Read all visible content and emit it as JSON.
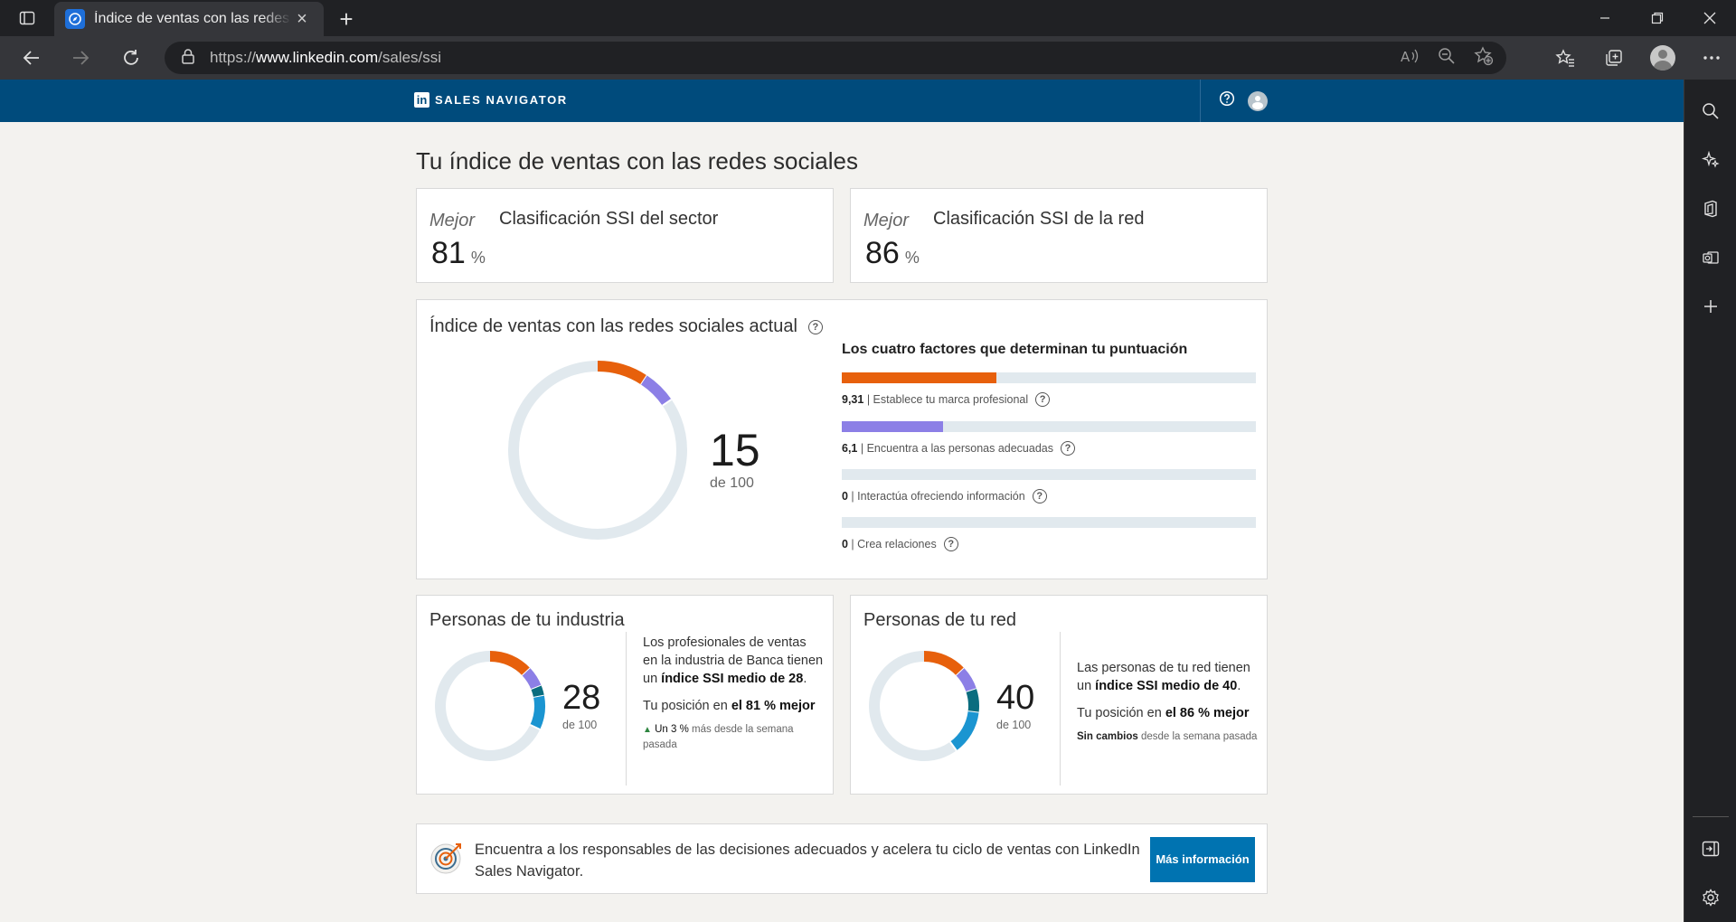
{
  "browser": {
    "tab_title": "Índice de ventas con las redes sociales",
    "url_prefix": "https://",
    "url_host": "www.linkedin.com",
    "url_path": "/sales/ssi"
  },
  "header": {
    "brand": "SALES NAVIGATOR",
    "help_icon": "help-circle-icon",
    "user_icon": "user-avatar-icon"
  },
  "page": {
    "title": "Tu índice de ventas con las redes sociales"
  },
  "rankings": [
    {
      "qualifier": "Mejor",
      "label": "Clasificación SSI del sector",
      "value": "81",
      "unit": "%"
    },
    {
      "qualifier": "Mejor",
      "label": "Clasificación SSI de la red",
      "value": "86",
      "unit": "%"
    }
  ],
  "ssi": {
    "title": "Índice de ventas con las redes sociales actual",
    "score": "15",
    "score_of": "de 100",
    "factors_title": "Los cuatro factores que determinan tu puntuación",
    "factors": [
      {
        "value": "9,31",
        "label": "Establece tu marca profesional",
        "fraction": 0.3724,
        "color": "#e7600c"
      },
      {
        "value": "6,1",
        "label": "Encuentra a las personas adecuadas",
        "fraction": 0.244,
        "color": "#8c7fe6"
      },
      {
        "value": "0",
        "label": "Interactúa ofreciendo información",
        "fraction": 0,
        "color": "#0e8fa8"
      },
      {
        "value": "0",
        "label": "Crea relaciones",
        "fraction": 0,
        "color": "#1b95d1"
      }
    ]
  },
  "industry": {
    "title": "Personas de tu industria",
    "score": "28",
    "score_of": "de 100",
    "text_1": "Los profesionales de ventas en la industria de Banca tienen un ",
    "text_bold": "índice SSI medio de 28",
    "text_2": ".",
    "position_prefix": "Tu posición en ",
    "position_bold": "el 81 % mejor",
    "change_bold": "Un 3 %",
    "change_rest": " más desde la semana pasada",
    "segments": [
      {
        "fraction": 0.13,
        "color": "#e7600c"
      },
      {
        "fraction": 0.06,
        "color": "#8c7fe6"
      },
      {
        "fraction": 0.03,
        "color": "#0a6d7f"
      },
      {
        "fraction": 0.1,
        "color": "#1b95d1"
      }
    ]
  },
  "network": {
    "title": "Personas de tu red",
    "score": "40",
    "score_of": "de 100",
    "text_1": "Las personas de tu red tienen un ",
    "text_bold": "índice SSI medio de 40",
    "text_2": ".",
    "position_prefix": "Tu posición en ",
    "position_bold": "el 86 % mejor",
    "change_bold": "Sin cambios",
    "change_rest": " desde la semana pasada",
    "segments": [
      {
        "fraction": 0.13,
        "color": "#e7600c"
      },
      {
        "fraction": 0.07,
        "color": "#8c7fe6"
      },
      {
        "fraction": 0.07,
        "color": "#0a6d7f"
      },
      {
        "fraction": 0.13,
        "color": "#1b95d1"
      }
    ]
  },
  "promo": {
    "text": "Encuentra a los responsables de las decisiones adecuados y acelera tu ciclo de ventas con LinkedIn Sales Navigator.",
    "button": "Más información",
    "icon": "target-icon"
  },
  "colors": {
    "header_bg": "#004b7c",
    "track": "#e1e9ee",
    "button": "#0073b1"
  }
}
